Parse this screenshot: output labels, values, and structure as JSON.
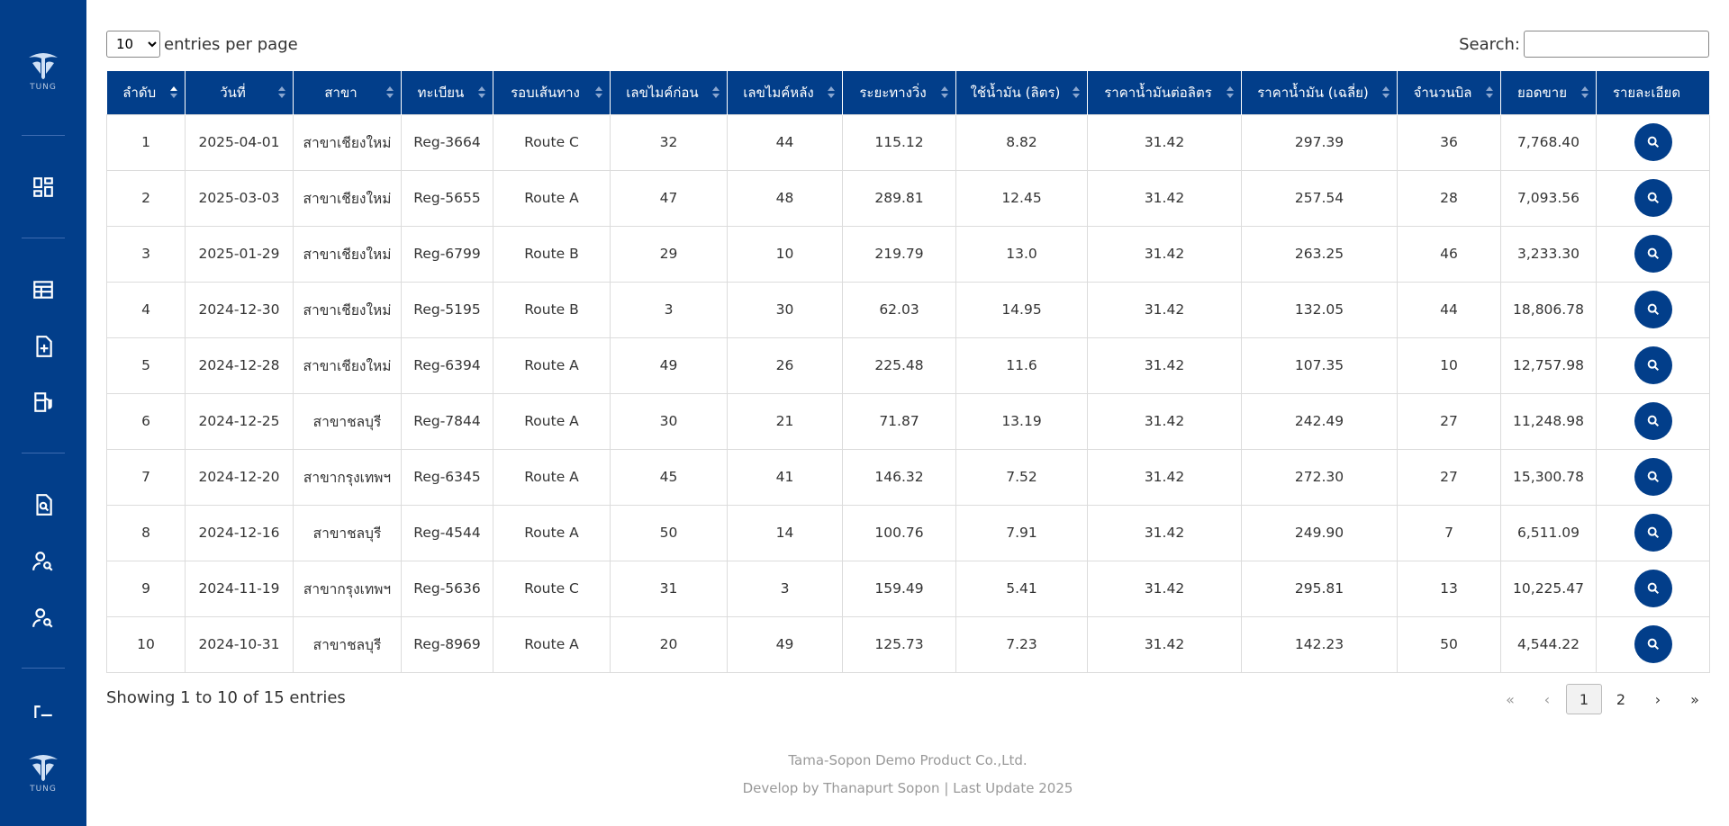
{
  "sidebar": {
    "logo_text": "TUNG",
    "colors": {
      "background": "#023e8a",
      "accent": "#ffffff"
    },
    "icons": [
      "dashboard-icon",
      "table-icon",
      "file-add-icon",
      "fuel-pump-icon",
      "file-search-icon",
      "user-search-icon",
      "user-search-2-icon",
      "logout-icon"
    ]
  },
  "controls": {
    "length_value": "10",
    "length_label": "entries per page",
    "search_label": "Search:",
    "search_value": ""
  },
  "table": {
    "headers": [
      "ลำดับ",
      "วันที่",
      "สาขา",
      "ทะเบียน",
      "รอบเส้นทาง",
      "เลขไมค์ก่อน",
      "เลขไมค์หลัง",
      "ระยะทางวิ่ง",
      "ใช้น้ำมัน (ลิตร)",
      "ราคาน้ำมันต่อลิตร",
      "ราคาน้ำมัน (เฉลี่ย)",
      "จำนวนบิล",
      "ยอดขาย",
      "รายละเอียด"
    ],
    "rows": [
      [
        "1",
        "2025-04-01",
        "สาขาเชียงใหม่",
        "Reg-3664",
        "Route C",
        "32",
        "44",
        "115.12",
        "8.82",
        "31.42",
        "297.39",
        "36",
        "7,768.40"
      ],
      [
        "2",
        "2025-03-03",
        "สาขาเชียงใหม่",
        "Reg-5655",
        "Route A",
        "47",
        "48",
        "289.81",
        "12.45",
        "31.42",
        "257.54",
        "28",
        "7,093.56"
      ],
      [
        "3",
        "2025-01-29",
        "สาขาเชียงใหม่",
        "Reg-6799",
        "Route B",
        "29",
        "10",
        "219.79",
        "13.0",
        "31.42",
        "263.25",
        "46",
        "3,233.30"
      ],
      [
        "4",
        "2024-12-30",
        "สาขาเชียงใหม่",
        "Reg-5195",
        "Route B",
        "3",
        "30",
        "62.03",
        "14.95",
        "31.42",
        "132.05",
        "44",
        "18,806.78"
      ],
      [
        "5",
        "2024-12-28",
        "สาขาเชียงใหม่",
        "Reg-6394",
        "Route A",
        "49",
        "26",
        "225.48",
        "11.6",
        "31.42",
        "107.35",
        "10",
        "12,757.98"
      ],
      [
        "6",
        "2024-12-25",
        "สาขาชลบุรี",
        "Reg-7844",
        "Route A",
        "30",
        "21",
        "71.87",
        "13.19",
        "31.42",
        "242.49",
        "27",
        "11,248.98"
      ],
      [
        "7",
        "2024-12-20",
        "สาขากรุงเทพฯ",
        "Reg-6345",
        "Route A",
        "45",
        "41",
        "146.32",
        "7.52",
        "31.42",
        "272.30",
        "27",
        "15,300.78"
      ],
      [
        "8",
        "2024-12-16",
        "สาขาชลบุรี",
        "Reg-4544",
        "Route A",
        "50",
        "14",
        "100.76",
        "7.91",
        "31.42",
        "249.90",
        "7",
        "6,511.09"
      ],
      [
        "9",
        "2024-11-19",
        "สาขากรุงเทพฯ",
        "Reg-5636",
        "Route C",
        "31",
        "3",
        "159.49",
        "5.41",
        "31.42",
        "295.81",
        "13",
        "10,225.47"
      ],
      [
        "10",
        "2024-10-31",
        "สาขาชลบุรี",
        "Reg-8969",
        "Route A",
        "20",
        "49",
        "125.73",
        "7.23",
        "31.42",
        "142.23",
        "50",
        "4,544.22"
      ]
    ]
  },
  "info": "Showing 1 to 10 of 15 entries",
  "pagination": {
    "first": "«",
    "prev": "‹",
    "pages": [
      "1",
      "2"
    ],
    "current": "1",
    "next": "›",
    "last": "»"
  },
  "footer": {
    "line1": "Tama-Sopon Demo Product Co.,Ltd.",
    "line2": "Develop by Thanapurt Sopon | Last Update 2025"
  }
}
